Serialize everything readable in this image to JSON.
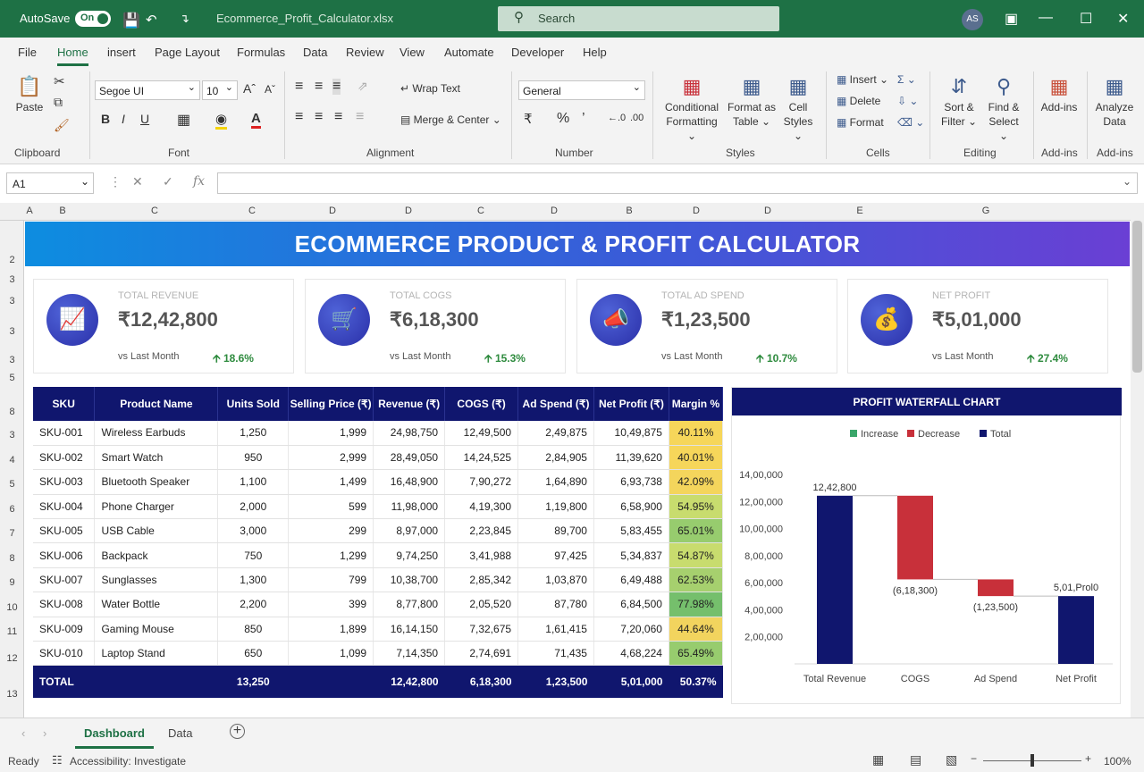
{
  "titlebar": {
    "autosave": "AutoSave",
    "autosave_state": "On",
    "filename": "Ecommerce_Profit_Calculator.xlsx",
    "search_placeholder": "Search",
    "avatar": "AS"
  },
  "menu": [
    "File",
    "Home",
    "insert",
    "Page Layout",
    "Formulas",
    "Data",
    "Review",
    "View",
    "Automate",
    "Developer",
    "Help"
  ],
  "ribbon": {
    "paste": "Paste",
    "font_name": "Segoe UI",
    "font_size": "10",
    "wrap_text": "Wrap Text",
    "merge_center": "Merge & Center",
    "number_format": "General",
    "conditional_formatting_1": "Conditional",
    "conditional_formatting_2": "Formatting",
    "format_as_table_1": "Format as",
    "format_as_table_2": "Table",
    "cell_styles_1": "Cell",
    "cell_styles_2": "Styles",
    "insert": "Insert",
    "delete": "Delete",
    "format": "Format",
    "sort_filter_1": "Sort &",
    "sort_filter_2": "Filter",
    "find_select_1": "Find &",
    "find_select_2": "Select",
    "addins": "Add-ins",
    "analyze_1": "Analyze",
    "analyze_2": "Data",
    "groups": [
      "Clipboard",
      "Font",
      "Alignment",
      "Number",
      "Styles",
      "Cells",
      "Editing",
      "Add-ins",
      "Add-ins"
    ]
  },
  "formula_bar": {
    "name_box": "A1",
    "fx": "fx"
  },
  "columns": [
    "A",
    "B",
    "C",
    "C",
    "D",
    "D",
    "C",
    "D",
    "B",
    "D",
    "D",
    "E",
    "G"
  ],
  "rows": [
    "2",
    "3",
    "3",
    "3",
    "3",
    "5",
    "8",
    "3",
    "4",
    "5",
    "6",
    "7",
    "8",
    "9",
    "10",
    "11",
    "12",
    "13"
  ],
  "dashboard": {
    "title": "ECOMMERCE PRODUCT & PROFIT CALCULATOR",
    "kpis": [
      {
        "label": "TOTAL REVENUE",
        "value": "₹12,42,800",
        "vs": "vs Last Month",
        "change": "18.6%",
        "icon": "bar-chart-icon"
      },
      {
        "label": "TOTAL COGS",
        "value": "₹6,18,300",
        "vs": "vs Last Month",
        "change": "15.3%",
        "icon": "cart-icon"
      },
      {
        "label": "TOTAL AD SPEND",
        "value": "₹1,23,500",
        "vs": "vs Last Month",
        "change": "10.7%",
        "icon": "megaphone-icon"
      },
      {
        "label": "NET PROFIT",
        "value": "₹5,01,000",
        "vs": "vs Last Month",
        "change": "27.4%",
        "icon": "money-bag-icon"
      }
    ],
    "table": {
      "headers": [
        "SKU",
        "Product Name",
        "Units Sold",
        "Selling Price (₹)",
        "Revenue (₹)",
        "COGS (₹)",
        "Ad Spend (₹)",
        "Net Profit (₹)",
        "Margin %"
      ],
      "rows": [
        [
          "SKU-001",
          "Wireless Earbuds",
          "1,250",
          "1,999",
          "24,98,750",
          "12,49,500",
          "2,49,875",
          "10,49,875",
          "40.11%"
        ],
        [
          "SKU-002",
          "Smart Watch",
          "950",
          "2,999",
          "28,49,050",
          "14,24,525",
          "2,84,905",
          "11,39,620",
          "40.01%"
        ],
        [
          "SKU-003",
          "Bluetooth Speaker",
          "1,100",
          "1,499",
          "16,48,900",
          "7,90,272",
          "1,64,890",
          "6,93,738",
          "42.09%"
        ],
        [
          "SKU-004",
          "Phone Charger",
          "2,000",
          "599",
          "11,98,000",
          "4,19,300",
          "1,19,800",
          "6,58,900",
          "54.95%"
        ],
        [
          "SKU-005",
          "USB Cable",
          "3,000",
          "299",
          "8,97,000",
          "2,23,845",
          "89,700",
          "5,83,455",
          "65.01%"
        ],
        [
          "SKU-006",
          "Backpack",
          "750",
          "1,299",
          "9,74,250",
          "3,41,988",
          "97,425",
          "5,34,837",
          "54.87%"
        ],
        [
          "SKU-007",
          "Sunglasses",
          "1,300",
          "799",
          "10,38,700",
          "2,85,342",
          "1,03,870",
          "6,49,488",
          "62.53%"
        ],
        [
          "SKU-008",
          "Water Bottle",
          "2,200",
          "399",
          "8,77,800",
          "2,05,520",
          "87,780",
          "6,84,500",
          "77.98%"
        ],
        [
          "SKU-009",
          "Gaming Mouse",
          "850",
          "1,899",
          "16,14,150",
          "7,32,675",
          "1,61,415",
          "7,20,060",
          "44.64%"
        ],
        [
          "SKU-010",
          "Laptop Stand",
          "650",
          "1,099",
          "7,14,350",
          "2,74,691",
          "71,435",
          "4,68,224",
          "65.49%"
        ]
      ],
      "total": [
        "TOTAL",
        "",
        "13,250",
        "",
        "12,42,800",
        "6,18,300",
        "1,23,500",
        "5,01,000",
        "50.37%"
      ]
    }
  },
  "chart_data": {
    "type": "bar",
    "title": "PROFIT WATERFALL CHART",
    "legend": [
      "Increase",
      "Decrease",
      "Total"
    ],
    "legend_position": "top",
    "categories": [
      "Total Revenue",
      "COGS",
      "Ad Spend",
      "Net Profit"
    ],
    "bars": [
      {
        "kind": "Total",
        "start": 0,
        "end": 1242800,
        "label": "12,42,800"
      },
      {
        "kind": "Decrease",
        "start": 1242800,
        "end": 624500,
        "label": "(6,18,300)"
      },
      {
        "kind": "Decrease",
        "start": 624500,
        "end": 501000,
        "label": "(1,23,500)"
      },
      {
        "kind": "Total",
        "start": 0,
        "end": 501000,
        "label": "5,01,Prol0"
      }
    ],
    "ylim": [
      0,
      1400000
    ],
    "yticks": [
      "14,00,000",
      "12,00,000",
      "10,00,000",
      "8,00,000",
      "6,00,000",
      "4,00,000",
      "2,00,000"
    ],
    "ytick_values": [
      1400000,
      1200000,
      1000000,
      800000,
      600000,
      400000,
      200000
    ],
    "colors": {
      "Increase": "#3aa66a",
      "Decrease": "#c8303a",
      "Total": "#10166e"
    }
  },
  "sheets": [
    "Dashboard",
    "Data"
  ],
  "status": {
    "ready": "Ready",
    "accessibility": "Accessibility: Investigate",
    "zoom": "100%"
  },
  "margin_colors": [
    "#f6d65a",
    "#f6d65a",
    "#f4d55c",
    "#c8dc6e",
    "#97cc6e",
    "#c8dc6e",
    "#a6d06e",
    "#75bf6c",
    "#f2d45e",
    "#97cc6e"
  ]
}
